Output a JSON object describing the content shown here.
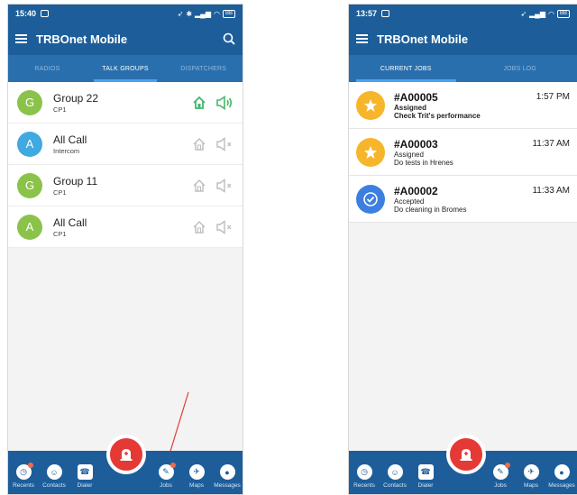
{
  "left_screen": {
    "status": {
      "time": "15:40",
      "battery": "BB"
    },
    "app_title": "TRBOnet Mobile",
    "tabs": [
      "RADIOS",
      "TALK GROUPS",
      "DISPATCHERS"
    ],
    "active_tab": 1,
    "groups": [
      {
        "initial": "G",
        "name": "Group 22",
        "sub": "CP1",
        "color": "#8bc34a",
        "active": true
      },
      {
        "initial": "A",
        "name": "All Call",
        "sub": "Intercom",
        "color": "#3fa9e0",
        "active": false
      },
      {
        "initial": "G",
        "name": "Group 11",
        "sub": "CP1",
        "color": "#8bc34a",
        "active": false
      },
      {
        "initial": "A",
        "name": "All Call",
        "sub": "CP1",
        "color": "#8bc34a",
        "active": false
      }
    ],
    "nav": {
      "recents": "Recents",
      "contacts": "Contacts",
      "dialer": "Dialer",
      "jobs": "Jobs",
      "maps": "Maps",
      "messages": "Messages"
    }
  },
  "right_screen": {
    "status": {
      "time": "13:57",
      "battery": "BB"
    },
    "app_title": "TRBOnet Mobile",
    "tabs": [
      "CURRENT JOBS",
      "JOBS LOG"
    ],
    "active_tab": 0,
    "jobs": [
      {
        "id": "#A00005",
        "status": "Assigned",
        "desc": "Check Trit's performance",
        "time": "1:57 PM",
        "icon": "star-icon",
        "color": "#f7b52b",
        "bold": true
      },
      {
        "id": "#A00003",
        "status": "Assigned",
        "desc": "Do tests in Hrenes",
        "time": "11:37 AM",
        "icon": "star-icon",
        "color": "#f7b52b",
        "bold": false
      },
      {
        "id": "#A00002",
        "status": "Accepted",
        "desc": "Do cleaning in Bromes",
        "time": "11:33 AM",
        "icon": "check-icon",
        "color": "#3d7fe0",
        "bold": false
      }
    ],
    "nav": {
      "recents": "Recents",
      "contacts": "Contacts",
      "dialer": "Dialer",
      "jobs": "Jobs",
      "maps": "Maps",
      "messages": "Messages"
    }
  },
  "colors": {
    "primary": "#1d5e9a",
    "tab_bar": "#2a6fad",
    "active_green": "#43b86b",
    "fab_red": "#e53935"
  }
}
